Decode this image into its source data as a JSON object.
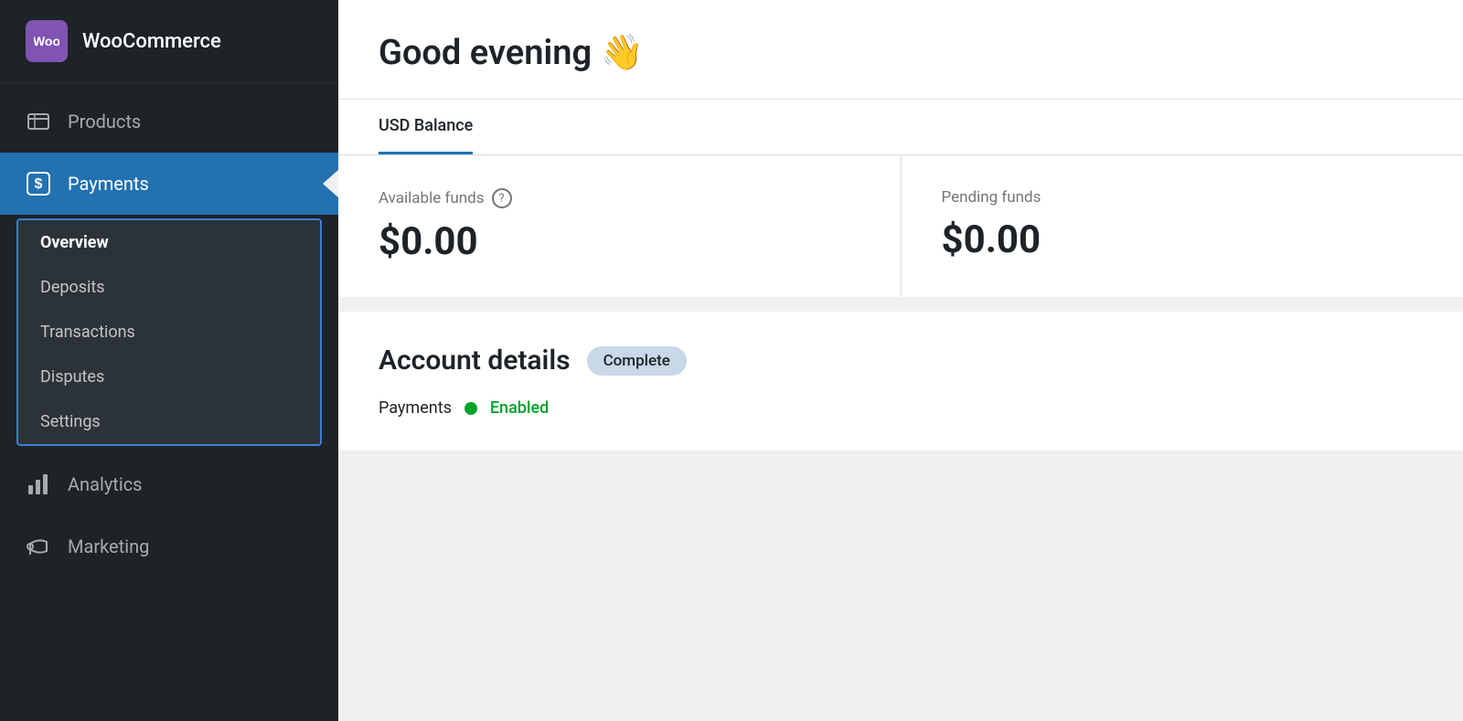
{
  "sidebar": {
    "logo": {
      "icon_text": "woo",
      "label": "WooCommerce"
    },
    "items": [
      {
        "id": "products",
        "label": "Products",
        "icon": "🛒"
      },
      {
        "id": "payments",
        "label": "Payments",
        "icon": "$",
        "active": true
      },
      {
        "id": "analytics",
        "label": "Analytics",
        "icon": "📊"
      },
      {
        "id": "marketing",
        "label": "Marketing",
        "icon": "📣"
      }
    ],
    "submenu": {
      "items": [
        {
          "id": "overview",
          "label": "Overview",
          "active": true
        },
        {
          "id": "deposits",
          "label": "Deposits"
        },
        {
          "id": "transactions",
          "label": "Transactions"
        },
        {
          "id": "disputes",
          "label": "Disputes"
        },
        {
          "id": "settings",
          "label": "Settings"
        }
      ]
    }
  },
  "main": {
    "greeting": {
      "text": "Good evening 👋"
    },
    "balance": {
      "tab_label": "USD Balance",
      "available_funds_label": "Available funds",
      "available_funds_value": "$0.00",
      "pending_funds_label": "Pending funds",
      "pending_funds_value": "$0.00"
    },
    "account": {
      "title": "Account details",
      "badge": "Complete",
      "row_label": "Payments",
      "status_label": "Enabled"
    }
  }
}
